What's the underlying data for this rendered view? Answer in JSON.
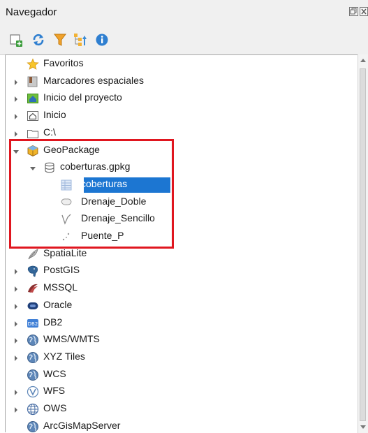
{
  "window": {
    "title": "Navegador",
    "float_icon": "float-icon",
    "close_icon": "close-icon"
  },
  "toolbar": {
    "buttons": [
      {
        "name": "add-selected-layers-button",
        "icon": "add-layer-icon"
      },
      {
        "name": "refresh-button",
        "icon": "refresh-icon"
      },
      {
        "name": "filter-browser-button",
        "icon": "filter-icon"
      },
      {
        "name": "collapse-all-button",
        "icon": "collapse-icon"
      },
      {
        "name": "properties-button",
        "icon": "info-icon"
      }
    ]
  },
  "tree": {
    "items": [
      {
        "label": "Favoritos",
        "icon": "star-icon",
        "level": 0,
        "arrow": "none"
      },
      {
        "label": "Marcadores espaciales",
        "icon": "bookmark-icon",
        "level": 0,
        "arrow": "collapsed"
      },
      {
        "label": "Inicio del proyecto",
        "icon": "project-home-icon",
        "level": 0,
        "arrow": "collapsed"
      },
      {
        "label": "Inicio",
        "icon": "home-folder-icon",
        "level": 0,
        "arrow": "collapsed"
      },
      {
        "label": "C:\\",
        "icon": "drive-folder-icon",
        "level": 0,
        "arrow": "collapsed"
      },
      {
        "label": "GeoPackage",
        "icon": "geopackage-icon",
        "level": 0,
        "arrow": "expanded"
      },
      {
        "label": "coberturas.gpkg",
        "icon": "database-icon",
        "level": 1,
        "arrow": "expanded"
      },
      {
        "label": "coberturas",
        "icon": "table-icon",
        "level": 2,
        "arrow": "none",
        "selected": true
      },
      {
        "label": "Drenaje_Doble",
        "icon": "polygon-icon",
        "level": 2,
        "arrow": "none"
      },
      {
        "label": "Drenaje_Sencillo",
        "icon": "line-icon",
        "level": 2,
        "arrow": "none"
      },
      {
        "label": "Puente_P",
        "icon": "point-icon",
        "level": 2,
        "arrow": "none"
      },
      {
        "label": "SpatiaLite",
        "icon": "feather-icon",
        "level": 0,
        "arrow": "none"
      },
      {
        "label": "PostGIS",
        "icon": "elephant-icon",
        "level": 0,
        "arrow": "collapsed"
      },
      {
        "label": "MSSQL",
        "icon": "mssql-icon",
        "level": 0,
        "arrow": "collapsed"
      },
      {
        "label": "Oracle",
        "icon": "oracle-icon",
        "level": 0,
        "arrow": "collapsed"
      },
      {
        "label": "DB2",
        "icon": "db2-icon",
        "level": 0,
        "arrow": "collapsed"
      },
      {
        "label": "WMS/WMTS",
        "icon": "globe-icon",
        "level": 0,
        "arrow": "collapsed"
      },
      {
        "label": "XYZ Tiles",
        "icon": "globe-icon",
        "level": 0,
        "arrow": "collapsed"
      },
      {
        "label": "WCS",
        "icon": "globe-icon",
        "level": 0,
        "arrow": "none"
      },
      {
        "label": "WFS",
        "icon": "globe-v-icon",
        "level": 0,
        "arrow": "collapsed"
      },
      {
        "label": "OWS",
        "icon": "globe-outline-icon",
        "level": 0,
        "arrow": "collapsed"
      },
      {
        "label": "ArcGisMapServer",
        "icon": "globe-icon",
        "level": 0,
        "arrow": "none"
      }
    ]
  },
  "colors": {
    "selection": "#1c76d2",
    "highlight_box": "#e0161f"
  }
}
